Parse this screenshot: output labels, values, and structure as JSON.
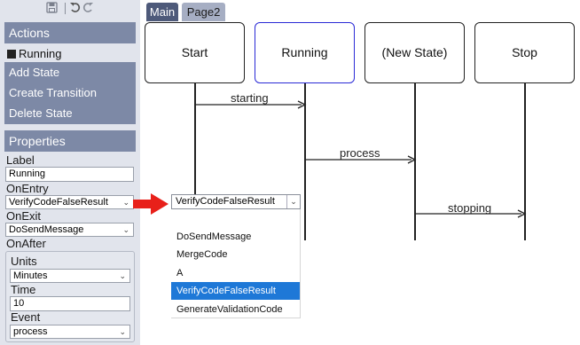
{
  "toolbar": {
    "save_icon": "floppy-disk-icon",
    "undo_icon": "undo-icon",
    "redo_icon": "redo-icon"
  },
  "actions": {
    "heading": "Actions",
    "current_state": "Running",
    "items": [
      "Add State",
      "Create Transition",
      "Delete State"
    ]
  },
  "properties": {
    "heading": "Properties",
    "label_caption": "Label",
    "label_value": "Running",
    "on_entry_caption": "OnEntry",
    "on_entry_value": "VerifyCodeFalseResult",
    "on_exit_caption": "OnExit",
    "on_exit_value": "DoSendMessage",
    "on_after_caption": "OnAfter",
    "units_caption": "Units",
    "units_value": "Minutes",
    "time_caption": "Time",
    "time_value": "10",
    "event_caption": "Event",
    "event_value": "process"
  },
  "tabs": [
    "Main",
    "Page2"
  ],
  "diagram": {
    "states": [
      "Start",
      "Running",
      "(New State)",
      "Stop"
    ],
    "selected_state": "Running",
    "transitions": [
      {
        "label": "starting",
        "from": "Start",
        "to": "Running"
      },
      {
        "label": "process",
        "from": "Running",
        "to": "(New State)"
      },
      {
        "label": "stopping",
        "from": "(New State)",
        "to": "Stop"
      }
    ]
  },
  "dropdown": {
    "value": "VerifyCodeFalseResult",
    "options": [
      "",
      "DoSendMessage",
      "MergeCode",
      "A",
      "VerifyCodeFalseResult",
      "GenerateValidationCode"
    ],
    "selected_option": "VerifyCodeFalseResult"
  },
  "colors": {
    "panel_bg": "#e1e4ec",
    "header_bg": "#7d89a6",
    "active_tab": "#4e5a7a",
    "selected_border": "#2a2ad6",
    "option_highlight": "#1e78d7",
    "pointer_arrow": "#e8201a"
  }
}
